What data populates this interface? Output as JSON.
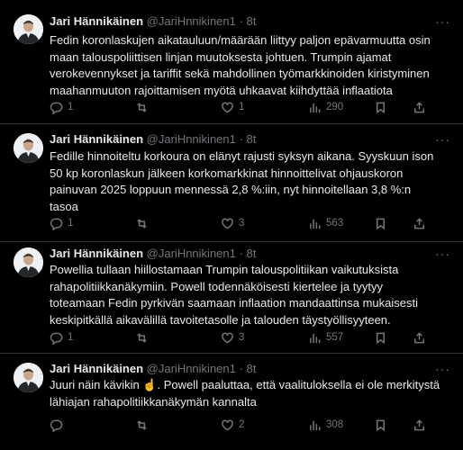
{
  "tweets": [
    {
      "name": "Jari Hännikäinen",
      "handle": "@JariHnnikinen1",
      "time": "8t",
      "lines": [
        "Fedin koronlaskujen aikatauluun/määrään liittyy paljon epävarmuutta osin",
        "maan talouspoliittisen linjan muutoksesta johtuen. Trumpin ajamat",
        "verokevennykset ja tariffit sekä mahdollinen työmarkkinoiden kiristyminen",
        "maahanmuuton rajoittamisen myötä uhkaavat kiihdyttää inflaatiota"
      ],
      "replies": "1",
      "retweets": "",
      "likes": "1",
      "views": "290"
    },
    {
      "name": "Jari Hännikäinen",
      "handle": "@JariHnnikinen1",
      "time": "8t",
      "lines": [
        "Fedille hinnoiteltu korkoura on elänyt rajusti syksyn aikana. Syyskuun ison",
        "50 kp koronlaskun jälkeen korkomarkkinat hinnoittelivat ohjauskoron",
        "painuvan 2025 loppuun mennessä 2,8 %:iin, nyt hinnoitellaan 3,8 %:n",
        "tasoa"
      ],
      "replies": "1",
      "retweets": "",
      "likes": "3",
      "views": "563"
    },
    {
      "name": "Jari Hännikäinen",
      "handle": "@JariHnnikinen1",
      "time": "8t",
      "lines": [
        "Powellia tullaan hiillostamaan Trumpin talouspolitiikan  vaikutuksista",
        "rahapolitiikkanäkymiin. Powell todennäköisesti kiertelee ja tyytyy",
        "toteamaan Fedin pyrkivän saamaan inflaation mandaattinsa mukaisesti",
        "keskipitkällä aikavälillä tavoitetasolle ja talouden täystyöllisyyteen."
      ],
      "replies": "1",
      "retweets": "",
      "likes": "3",
      "views": "557"
    },
    {
      "name": "Jari Hännikäinen",
      "handle": "@JariHnnikinen1",
      "time": "8t",
      "lines": [
        "Juuri näin kävikin ☝️. Powell paaluttaa, että vaalituloksella ei ole merkitystä",
        "lähiajan rahapolitiikkanäkymän kannalta"
      ],
      "replies": "",
      "retweets": "",
      "likes": "2",
      "views": "308"
    }
  ]
}
